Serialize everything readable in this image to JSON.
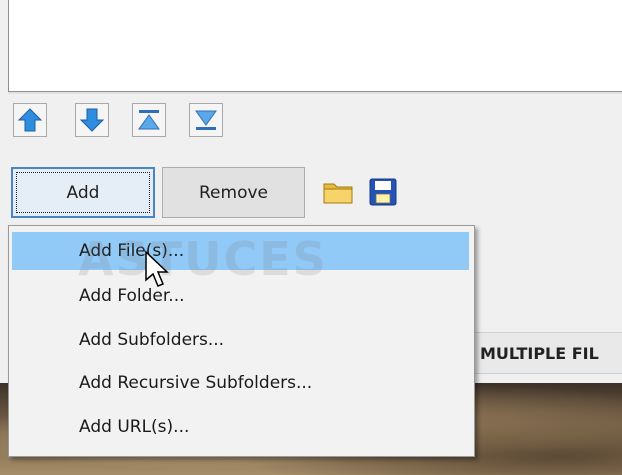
{
  "toolbar": {
    "add_label": "Add",
    "remove_label": "Remove"
  },
  "order_buttons": [
    "move-up-icon",
    "move-down-icon",
    "move-to-top-icon",
    "move-to-bottom-icon"
  ],
  "tool_icons": [
    "open-folder-icon",
    "save-icon"
  ],
  "add_menu": {
    "items": [
      {
        "label": "Add File(s)...",
        "state": "hover"
      },
      {
        "label": "Add Folder..."
      },
      {
        "label": "Add Subfolders..."
      },
      {
        "label": "Add Recursive Subfolders..."
      },
      {
        "label": "Add URL(s)..."
      }
    ]
  },
  "header_strip": {
    "text": "MULTIPLE FIL"
  },
  "watermark": {
    "text": "ASTUCES"
  },
  "colors": {
    "accent": "#4a86c6",
    "menu_hover": "#91c9f7",
    "arrow_blue": "#2f8de0"
  }
}
